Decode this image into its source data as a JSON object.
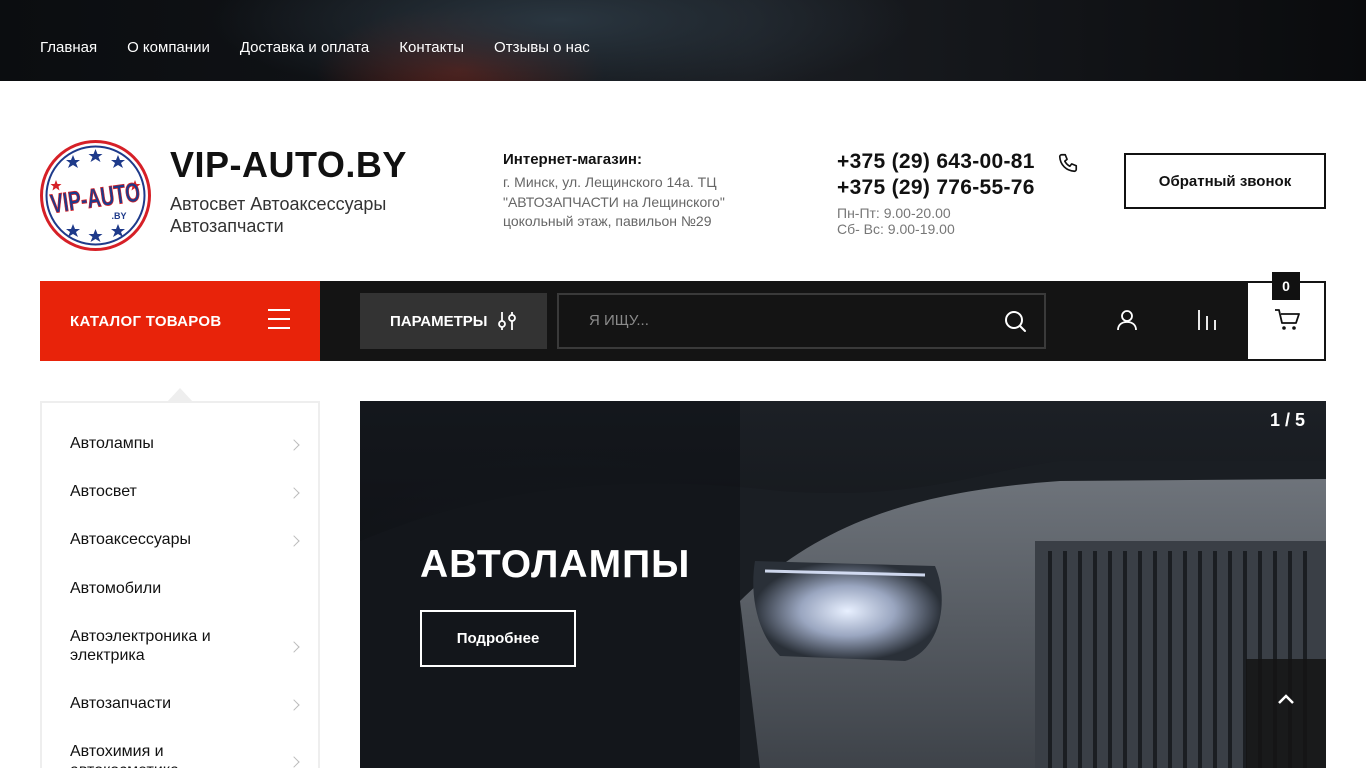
{
  "topnav": {
    "items": [
      "Главная",
      "О компании",
      "Доставка и оплата",
      "Контакты",
      "Отзывы о нас"
    ]
  },
  "header": {
    "logo_text": "VIP-AUTO .BY",
    "site_name": "VIP-AUTO.BY",
    "tagline": "Автосвет Автоаксессуары Автозапчасти",
    "shop_title": "Интернет-магазин:",
    "shop_address": "г. Минск, ул. Лещинского 14а. ТЦ \"АВТОЗАПЧАСТИ на Лещинского\" цокольный этаж, павильон №29",
    "phone1": "+375 (29) 643-00-81",
    "phone2": "+375 (29) 776-55-76",
    "hours1": "Пн-Пт: 9.00-20.00",
    "hours2": "Сб- Вс: 9.00-19.00",
    "callback_label": "Обратный звонок"
  },
  "toolbar": {
    "catalog_label": "КАТАЛОГ ТОВАРОВ",
    "params_label": "ПАРАМЕТРЫ",
    "search_placeholder": "Я ИЩУ...",
    "cart_count": "0"
  },
  "sidebar": {
    "items": [
      {
        "label": "Автолампы",
        "has_children": true
      },
      {
        "label": "Автосвет",
        "has_children": true
      },
      {
        "label": "Автоаксессуары",
        "has_children": true
      },
      {
        "label": "Автомобили",
        "has_children": false
      },
      {
        "label": "Автоэлектроника и электрика",
        "has_children": true
      },
      {
        "label": "Автозапчасти",
        "has_children": true
      },
      {
        "label": "Автохимия и автокосметика",
        "has_children": true
      }
    ]
  },
  "slider": {
    "counter": "1 / 5",
    "title": "АВТОЛАМПЫ",
    "button_label": "Подробнее"
  },
  "colors": {
    "accent": "#e8230a",
    "toolbar_bg": "#141414",
    "logo_blue": "#1e3a8a",
    "logo_red": "#d62027"
  }
}
